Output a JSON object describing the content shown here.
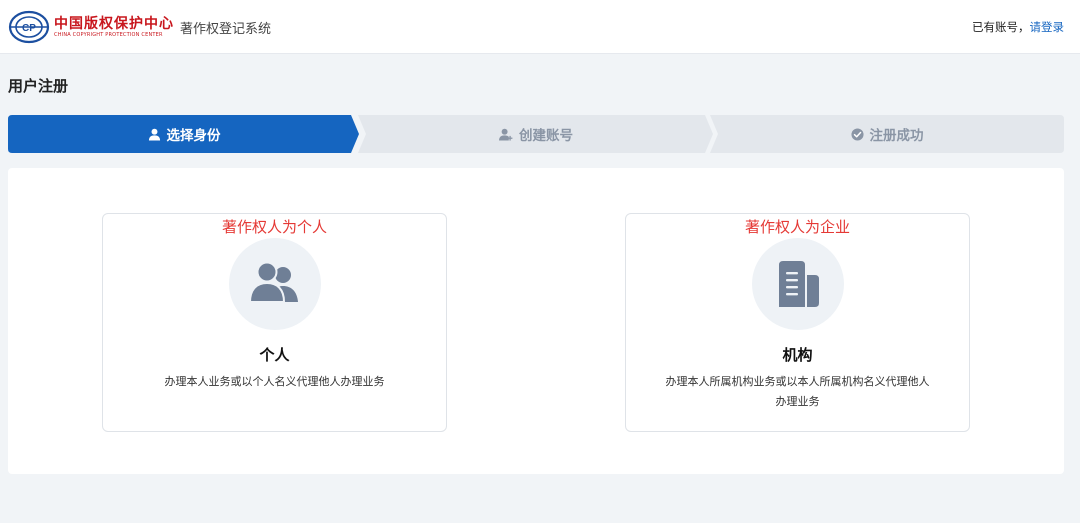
{
  "header": {
    "logo_cn": "中国版权保护中心",
    "logo_en": "CHINA COPYRIGHT PROTECTION CENTER",
    "system_title": "著作权登记系统",
    "login_prompt": "已有账号，",
    "login_link": "请登录"
  },
  "page": {
    "title": "用户注册"
  },
  "steps": [
    {
      "label": "选择身份",
      "icon": "user-icon",
      "state": "active"
    },
    {
      "label": "创建账号",
      "icon": "user-add-icon",
      "state": "inactive"
    },
    {
      "label": "注册成功",
      "icon": "check-circle-icon",
      "state": "inactive"
    }
  ],
  "cards": [
    {
      "caption": "著作权人为个人",
      "icon": "people-icon",
      "title": "个人",
      "description": "办理本人业务或以个人名义代理他人办理业务"
    },
    {
      "caption": "著作权人为企业",
      "icon": "building-icon",
      "title": "机构",
      "description": "办理本人所属机构业务或以本人所属机构名义代理他人办理业务"
    }
  ],
  "colors": {
    "primary": "#1565c0",
    "step_active": "#1565c0",
    "step_inactive": "#e3e7ec",
    "caption_red": "#e53935",
    "icon_gray": "#6f7f96",
    "brand_red": "#c8161d"
  }
}
